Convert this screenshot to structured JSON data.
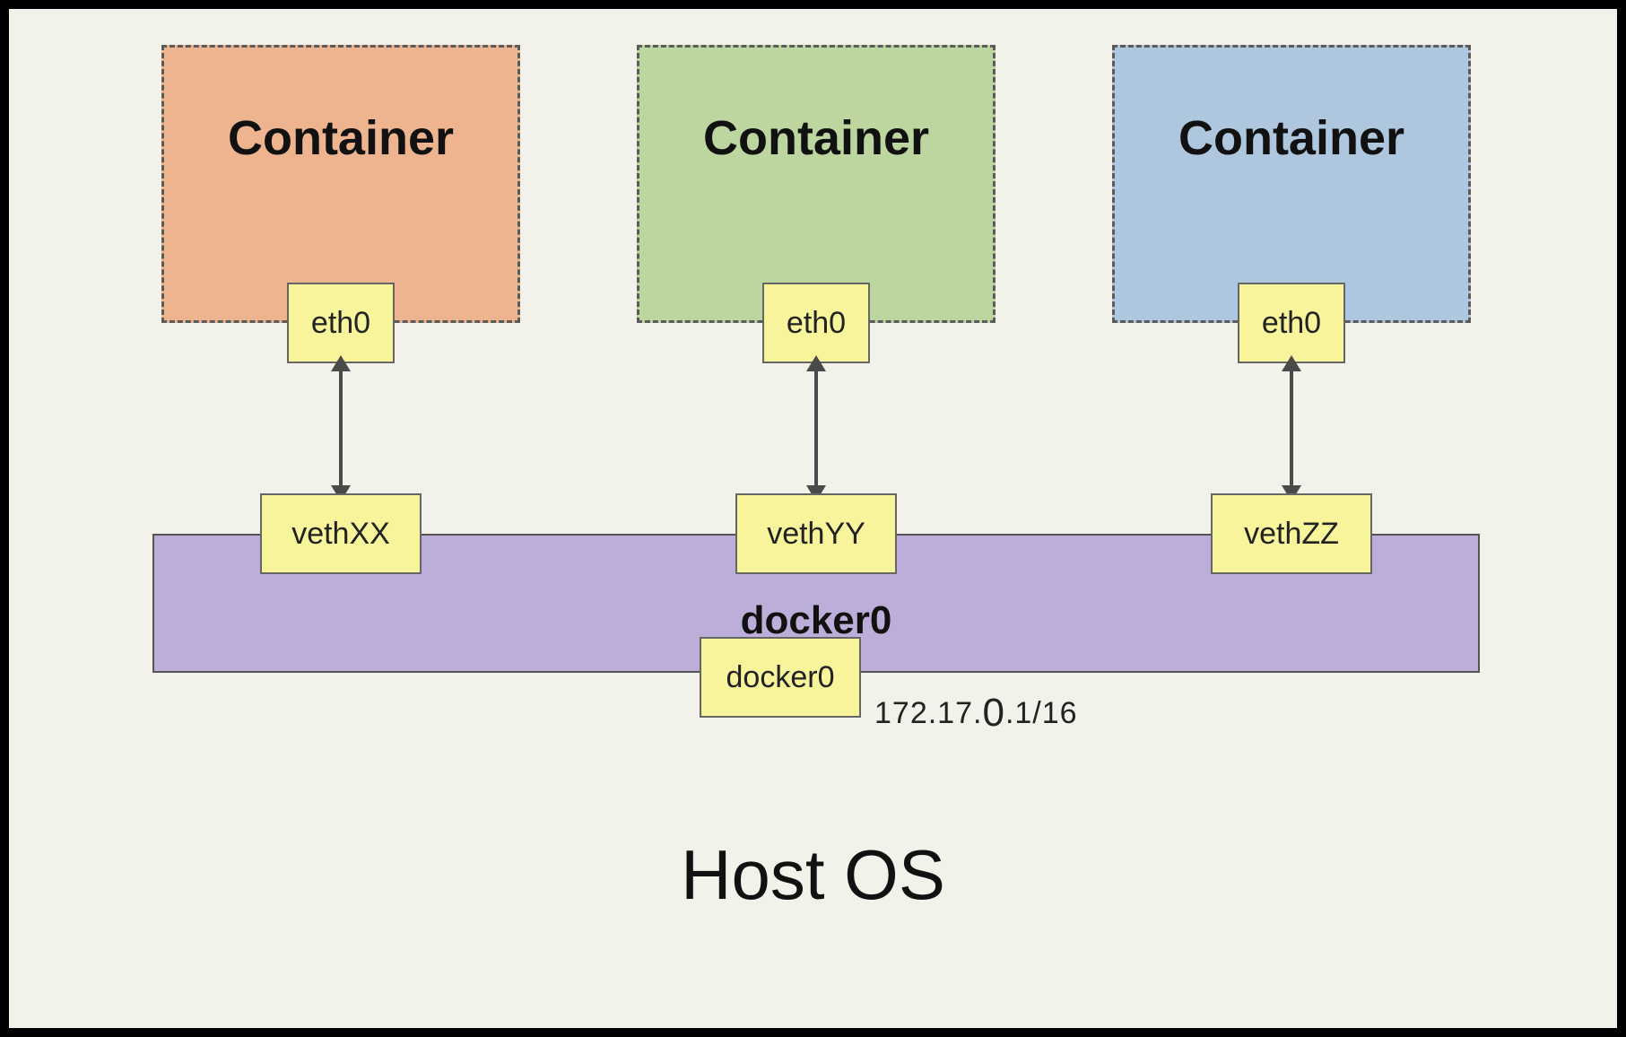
{
  "host_label": "Host OS",
  "containers": [
    {
      "title": "Container",
      "eth": "eth0",
      "veth": "vethXX"
    },
    {
      "title": "Container",
      "eth": "eth0",
      "veth": "vethYY"
    },
    {
      "title": "Container",
      "eth": "eth0",
      "veth": "vethZZ"
    }
  ],
  "bridge": {
    "name": "docker0",
    "iface": "docker0",
    "ip_prefix": "172.17.",
    "ip_zero": "0",
    "ip_suffix": ".1/16"
  }
}
